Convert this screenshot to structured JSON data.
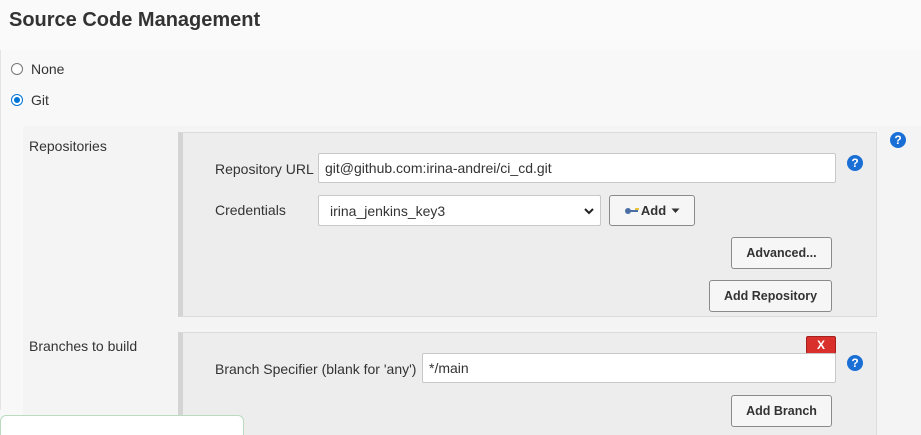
{
  "section": {
    "title": "Source Code Management"
  },
  "scm_options": [
    {
      "label": "None",
      "checked": false
    },
    {
      "label": "Git",
      "checked": true
    }
  ],
  "repositories": {
    "label": "Repositories",
    "repository_url_label": "Repository URL",
    "repository_url_value": "git@github.com:irina-andrei/ci_cd.git",
    "credentials_label": "Credentials",
    "credentials_selected": "irina_jenkins_key3",
    "add_label": "Add",
    "advanced_label": "Advanced...",
    "add_repository_label": "Add Repository"
  },
  "branches": {
    "label": "Branches to build",
    "delete_label": "X",
    "branch_specifier_label": "Branch Specifier (blank for 'any')",
    "branch_specifier_value": "*/main",
    "add_branch_label": "Add Branch"
  },
  "help": {
    "glyph": "?"
  },
  "icons": {
    "add_key": "key-icon",
    "dropdown": "caret-down-icon",
    "select": "chevron-down-icon",
    "help": "help-icon"
  },
  "colors": {
    "help_blue": "#1a6fd6",
    "radio_blue": "#0075d8",
    "delete_red": "#d9302b"
  }
}
